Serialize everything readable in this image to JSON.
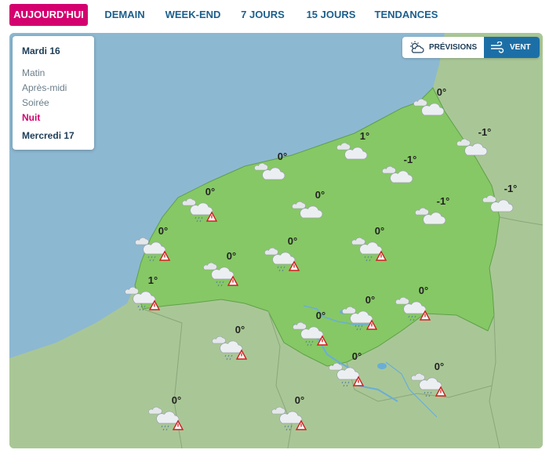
{
  "tabs": [
    {
      "label": "AUJOURD'HUI",
      "active": true
    },
    {
      "label": "DEMAIN",
      "active": false
    },
    {
      "label": "WEEK-END",
      "active": false
    },
    {
      "label": "7 JOURS",
      "active": false
    },
    {
      "label": "15 JOURS",
      "active": false
    },
    {
      "label": "TENDANCES",
      "active": false
    }
  ],
  "day_panel": {
    "day1": "Mardi 16",
    "periods": [
      "Matin",
      "Après-midi",
      "Soirée",
      "Nuit"
    ],
    "active_period": "Nuit",
    "day2": "Mercredi 17"
  },
  "view_toggle": {
    "previsions_label": "PRÉVISIONS",
    "vent_label": "VENT",
    "active": "VENT"
  },
  "colors": {
    "accent": "#d4006f",
    "tab_text": "#1c5f8c",
    "sea": "#8db8d2",
    "region": "#86c865",
    "neighbor_land": "#a9c796",
    "toggle_active": "#1c6fa6"
  },
  "stations": [
    {
      "temp": "0°",
      "icon": "cloud-icon"
    },
    {
      "temp": "-1°",
      "icon": "cloud-icon"
    },
    {
      "temp": "1°",
      "icon": "cloud-icon"
    },
    {
      "temp": "0°",
      "icon": "cloud-icon"
    },
    {
      "temp": "-1°",
      "icon": "cloud-icon"
    },
    {
      "temp": "-1°",
      "icon": "cloud-icon"
    },
    {
      "temp": "0°",
      "icon": "rain-warning-icon"
    },
    {
      "temp": "0°",
      "icon": "cloud-icon"
    },
    {
      "temp": "-1°",
      "icon": "cloud-icon"
    },
    {
      "temp": "0°",
      "icon": "rain-warning-icon"
    },
    {
      "temp": "0°",
      "icon": "rain-warning-icon"
    },
    {
      "temp": "0°",
      "icon": "rain-warning-icon"
    },
    {
      "temp": "0°",
      "icon": "rain-warning-icon"
    },
    {
      "temp": "1°",
      "icon": "rain-warning-icon"
    },
    {
      "temp": "0°",
      "icon": "rain-warning-icon"
    },
    {
      "temp": "0°",
      "icon": "rain-warning-icon"
    },
    {
      "temp": "0°",
      "icon": "rain-warning-icon"
    },
    {
      "temp": "0°",
      "icon": "rain-warning-icon"
    },
    {
      "temp": "0°",
      "icon": "rain-warning-icon"
    },
    {
      "temp": "0°",
      "icon": "rain-warning-icon"
    },
    {
      "temp": "0°",
      "icon": "rain-warning-icon"
    },
    {
      "temp": "0°",
      "icon": "rain-warning-icon"
    }
  ]
}
